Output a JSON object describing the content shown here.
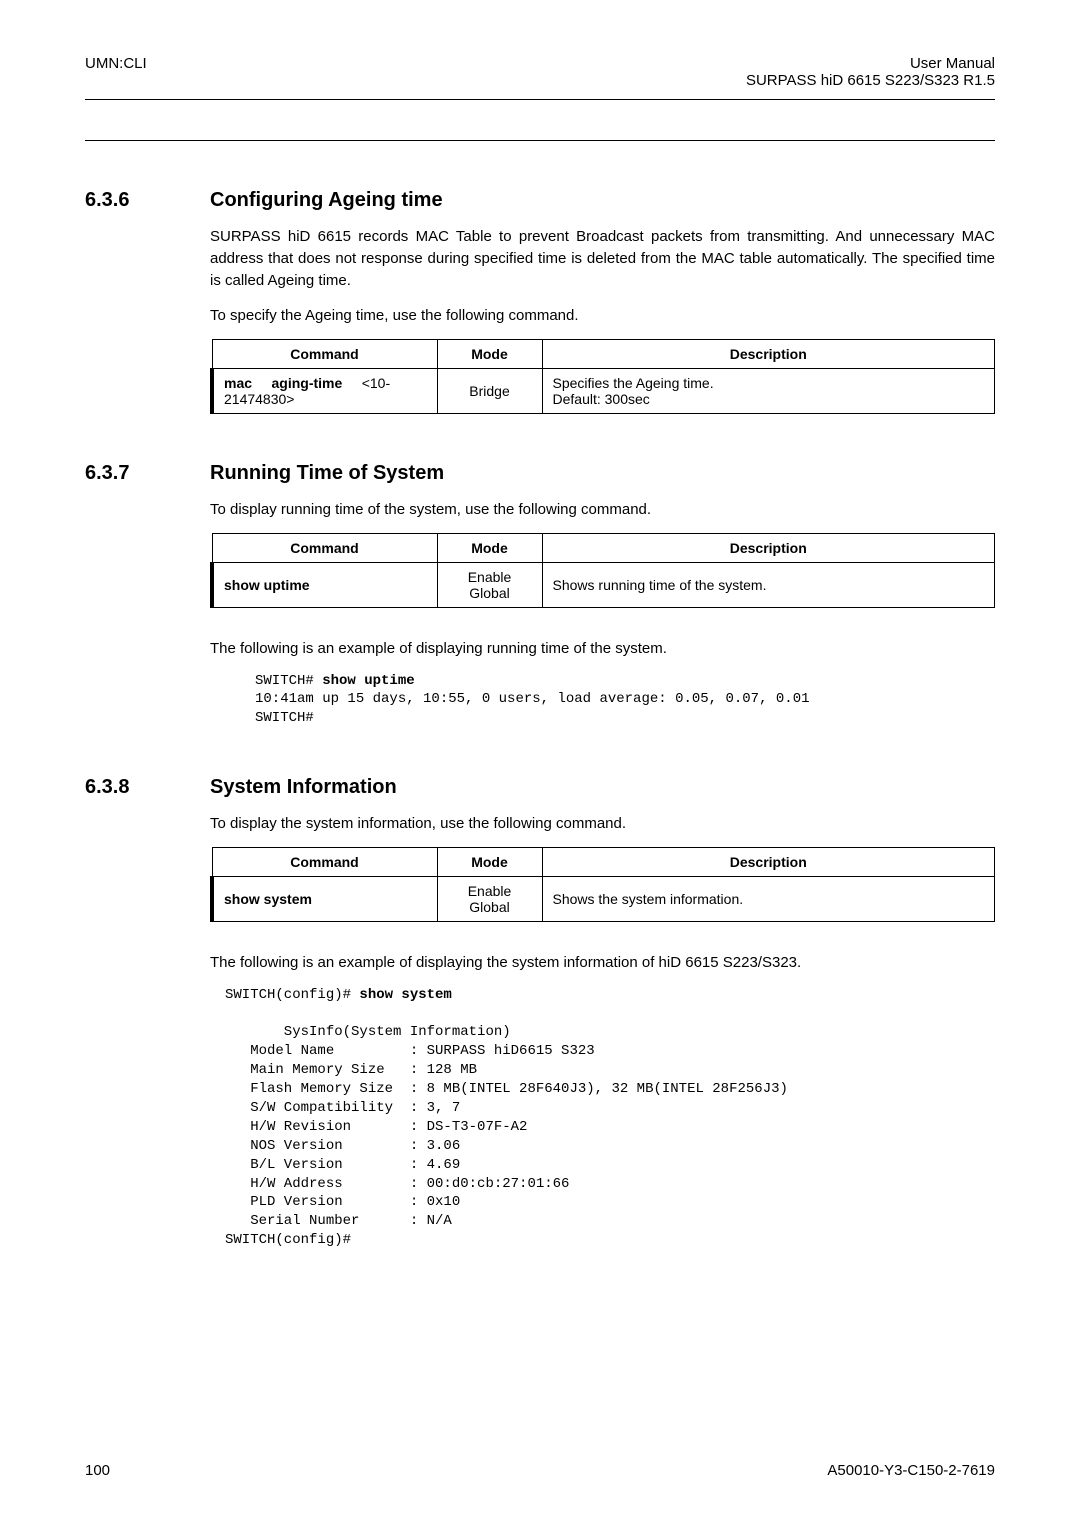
{
  "header": {
    "left": "UMN:CLI",
    "rightLine1": "User Manual",
    "rightLine2": "SURPASS hiD 6615 S223/S323 R1.5"
  },
  "s1": {
    "num": "6.3.6",
    "title": "Configuring Ageing time",
    "p1": "SURPASS hiD 6615 records MAC Table to prevent Broadcast packets from transmitting. And unnecessary MAC address that does not response during specified time is deleted from the MAC table automatically. The specified time is called Ageing time.",
    "p2": "To specify the Ageing time, use the following command.",
    "table": {
      "h1": "Command",
      "h2": "Mode",
      "h3": "Description",
      "cmdB1": "mac",
      "cmdB2": "aging-time",
      "cmdRest": "<10-21474830>",
      "mode": "Bridge",
      "descL1": "Specifies the Ageing time.",
      "descL2": "Default: 300sec"
    }
  },
  "s2": {
    "num": "6.3.7",
    "title": "Running Time of System",
    "p1": "To display running time of the system, use the following command.",
    "table": {
      "h1": "Command",
      "h2": "Mode",
      "h3": "Description",
      "cmd": "show uptime",
      "modeL1": "Enable",
      "modeL2": "Global",
      "desc": "Shows running time of the system."
    },
    "p2": "The following is an example of displaying running time of the system.",
    "code": {
      "l1a": "SWITCH# ",
      "l1b": "show uptime",
      "l2": "10:41am up 15 days, 10:55, 0 users, load average: 0.05, 0.07, 0.01",
      "l3": "SWITCH#"
    }
  },
  "s3": {
    "num": "6.3.8",
    "title": "System Information",
    "p1": "To display the system information, use the following command.",
    "table": {
      "h1": "Command",
      "h2": "Mode",
      "h3": "Description",
      "cmd": "show system",
      "modeL1": "Enable",
      "modeL2": "Global",
      "desc": "Shows the system information."
    },
    "p2": "The following is an example of displaying the system information of hiD 6615 S223/S323.",
    "code": {
      "l1a": "SWITCH(config)# ",
      "l1b": "show system",
      "l2": "",
      "l3": "       SysInfo(System Information)",
      "l4": "   Model Name         : SURPASS hiD6615 S323",
      "l5": "   Main Memory Size   : 128 MB",
      "l6": "   Flash Memory Size  : 8 MB(INTEL 28F640J3), 32 MB(INTEL 28F256J3)",
      "l7": "   S/W Compatibility  : 3, 7",
      "l8": "   H/W Revision       : DS-T3-07F-A2",
      "l9": "   NOS Version        : 3.06",
      "l10": "   B/L Version        : 4.69",
      "l11": "   H/W Address        : 00:d0:cb:27:01:66",
      "l12": "   PLD Version        : 0x10",
      "l13": "   Serial Number      : N/A",
      "l14": "SWITCH(config)#"
    }
  },
  "footer": {
    "left": "100",
    "right": "A50010-Y3-C150-2-7619"
  }
}
